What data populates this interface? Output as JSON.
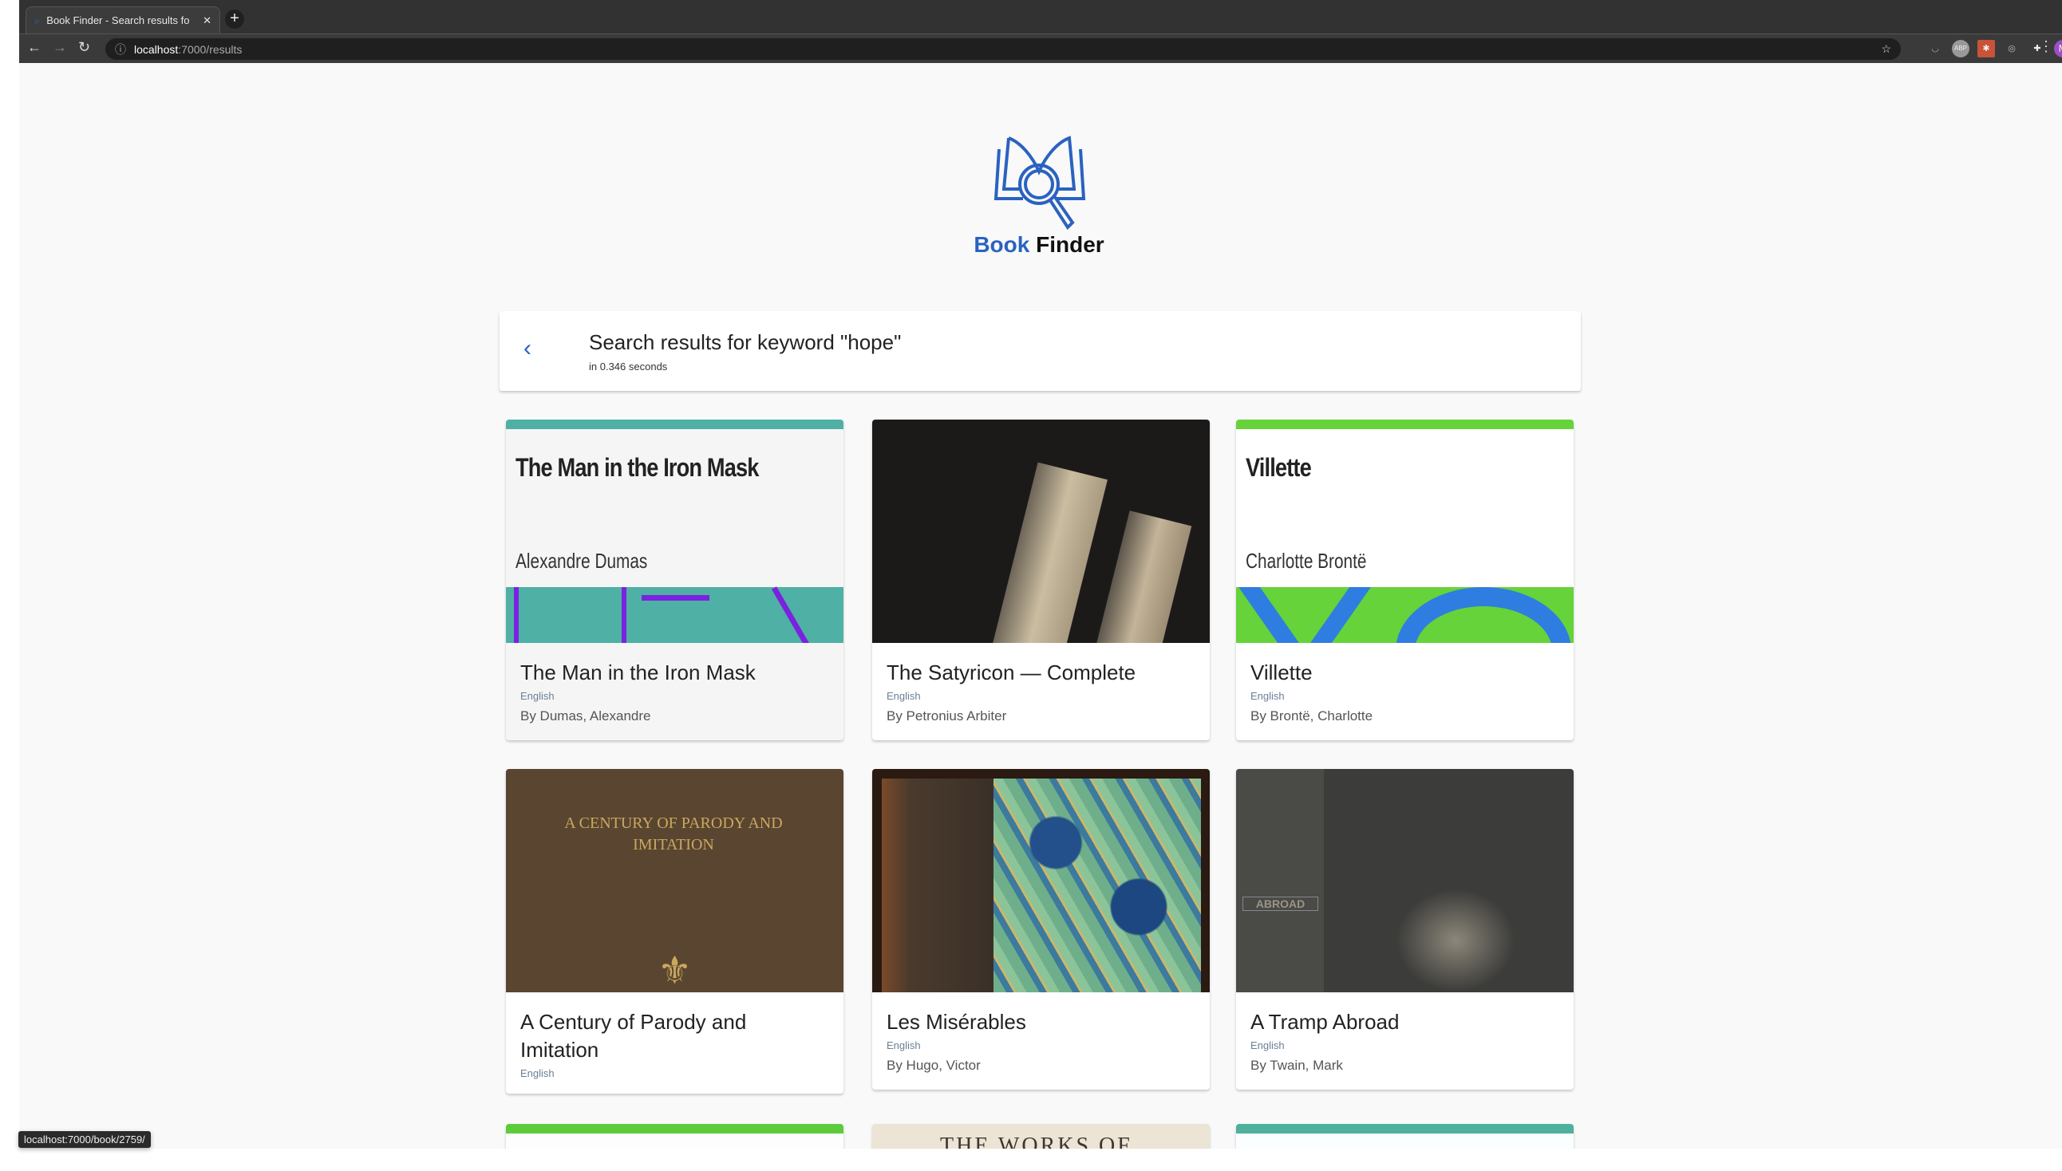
{
  "browser": {
    "tab_title": "Book Finder - Search results fo",
    "url_host": "localhost",
    "url_path": ":7000/results",
    "profile_initial": "M",
    "status_url": "localhost:7000/book/2759/"
  },
  "brand": {
    "book": "Book",
    "finder": "Finder"
  },
  "search": {
    "title": "Search results for keyword \"hope\"",
    "subtitle": "in 0.346 seconds"
  },
  "books": [
    {
      "title": "The Man in the Iron Mask",
      "language": "English",
      "author": "By Dumas, Alexandre",
      "cover_title": "The Man in the Iron Mask",
      "cover_author": "Alexandre Dumas",
      "accent": "#4fb0a5"
    },
    {
      "title": "The Satyricon — Complete",
      "language": "English",
      "author": "By Petronius Arbiter"
    },
    {
      "title": "Villette",
      "language": "English",
      "author": "By Brontë, Charlotte",
      "cover_title": "Villette",
      "cover_author": "Charlotte Brontë",
      "accent": "#66d33a"
    },
    {
      "title": "A Century of Parody and Imitation",
      "language": "English",
      "cover_text": "A CENTURY OF PARODY AND IMITATION"
    },
    {
      "title": "Les Misérables",
      "language": "English",
      "author": "By Hugo, Victor"
    },
    {
      "title": "A Tramp Abroad",
      "language": "English",
      "author": "By Twain, Mark",
      "cover_text": "ABROAD"
    }
  ],
  "partial_covers": {
    "middle_text": "THE WORKS OF"
  },
  "colors": {
    "brand_blue": "#2a62c0"
  }
}
